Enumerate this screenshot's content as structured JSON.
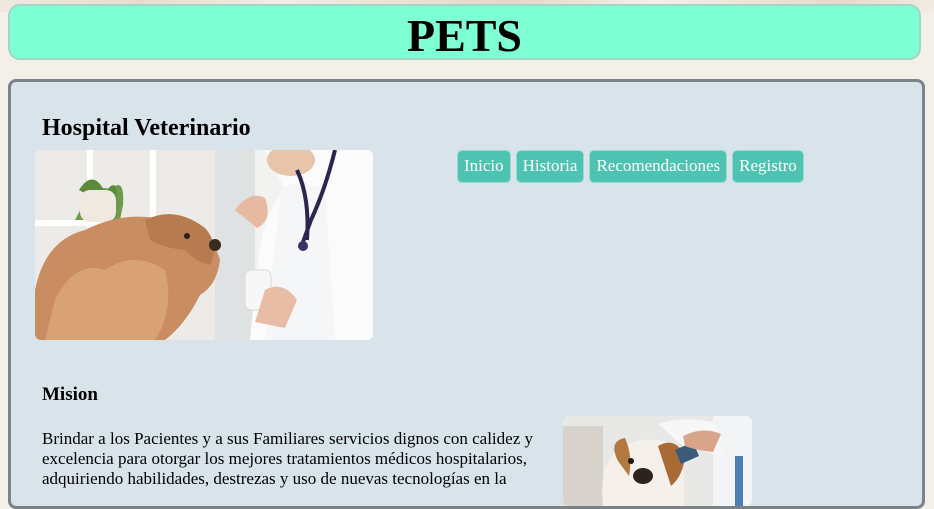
{
  "header": {
    "title": "PETS"
  },
  "main": {
    "title": "Hospital Veterinario",
    "nav": [
      {
        "label": "Inicio"
      },
      {
        "label": "Historia"
      },
      {
        "label": "Recomendaciones"
      },
      {
        "label": "Registro"
      }
    ],
    "mision": {
      "title": "Mision",
      "text": "Brindar a los Pacientes y a sus Familiares servicios dignos con calidez y excelencia para otorgar los mejores tratamientos médicos hospitalarios, adquiriendo habilidades, destrezas y uso de nuevas tecnologías en la"
    }
  },
  "colors": {
    "header_bg": "#7fffd4",
    "panel_bg": "#d8e3ea",
    "nav_button_bg": "#4fc3b2"
  }
}
